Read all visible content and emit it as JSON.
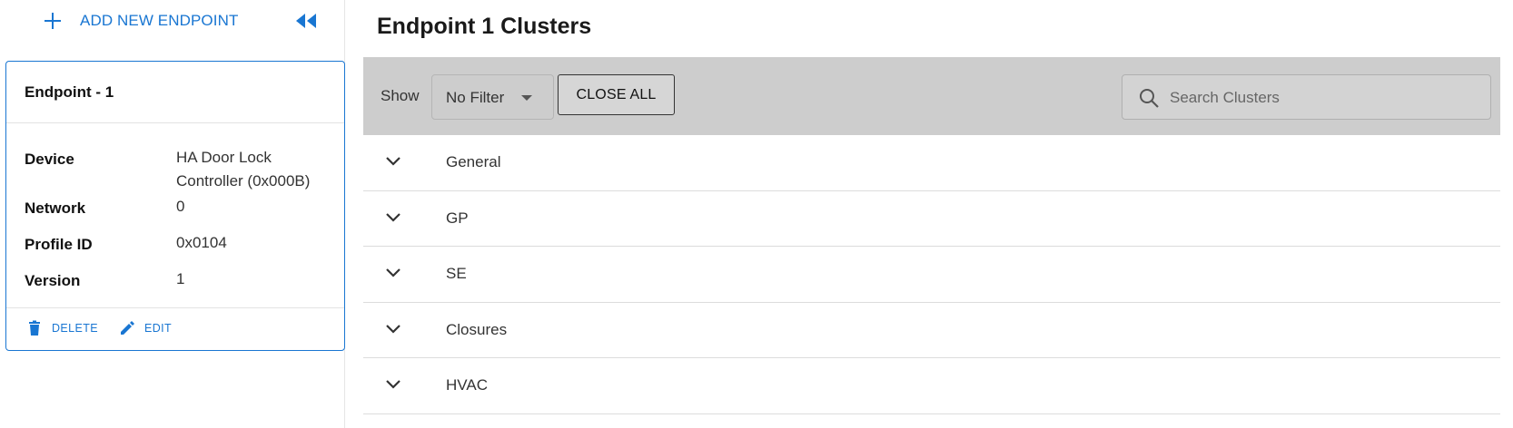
{
  "sidebar": {
    "add_endpoint_label": "ADD NEW ENDPOINT",
    "endpoint_card": {
      "title": "Endpoint - 1",
      "properties": [
        {
          "label": "Device",
          "value": "HA Door Lock Controller (0x000B)"
        },
        {
          "label": "Network",
          "value": "0"
        },
        {
          "label": "Profile ID",
          "value": "0x0104"
        },
        {
          "label": "Version",
          "value": "1"
        }
      ],
      "delete_label": "DELETE",
      "edit_label": "EDIT"
    }
  },
  "main": {
    "title": "Endpoint 1 Clusters",
    "toolbar": {
      "show_label": "Show",
      "filter_value": "No Filter",
      "close_all_label": "CLOSE ALL",
      "search_placeholder": "Search Clusters"
    },
    "clusters": [
      "General",
      "GP",
      "SE",
      "Closures",
      "HVAC"
    ]
  },
  "colors": {
    "accent": "#1976d2",
    "toolbar_bg": "#cdcdcd"
  },
  "icons": {
    "add": "plus-icon",
    "collapse": "double-chevron-left-icon",
    "delete": "trash-icon",
    "edit": "pencil-icon",
    "search": "search-icon",
    "expand": "chevron-down-icon",
    "filter": "dropdown-arrow-icon"
  }
}
